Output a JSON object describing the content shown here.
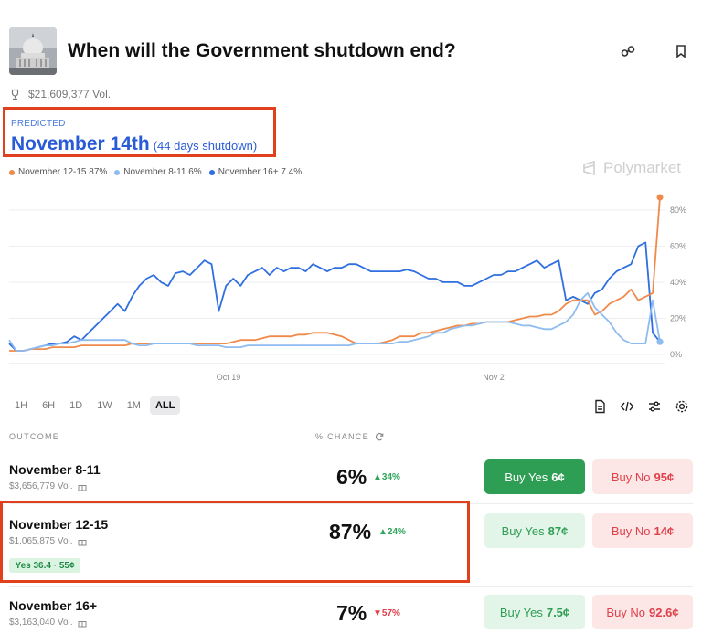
{
  "market": {
    "title": "When will the Government shutdown end?",
    "volume": "$21,609,377 Vol.",
    "predicted_label": "PREDICTED",
    "predicted_value": "November 14th",
    "predicted_note": "(44 days shutdown)",
    "watermark": "Polymarket"
  },
  "legend": [
    {
      "label": "November 12-15 87%",
      "color": "#f08a4b"
    },
    {
      "label": "November 8-11 6%",
      "color": "#8fbcf0"
    },
    {
      "label": "November 16+ 7.4%",
      "color": "#2f6fe0"
    }
  ],
  "time_ranges": [
    "1H",
    "6H",
    "1D",
    "1W",
    "1M",
    "ALL"
  ],
  "active_range": "ALL",
  "table": {
    "col_outcome": "OUTCOME",
    "col_chance": "% CHANCE"
  },
  "outcomes": [
    {
      "name": "November 8-11",
      "volume": "$3,656,779 Vol.",
      "chance": "6%",
      "delta": "34%",
      "delta_dir": "up",
      "yes_label": "Buy Yes",
      "yes_price": "6¢",
      "no_label": "Buy No",
      "no_price": "95¢"
    },
    {
      "name": "November 12-15",
      "volume": "$1,065,875 Vol.",
      "chance": "87%",
      "delta": "24%",
      "delta_dir": "up",
      "yes_label": "Buy Yes",
      "yes_price": "87¢",
      "no_label": "Buy No",
      "no_price": "14¢",
      "badge": "Yes 36.4 · 55¢"
    },
    {
      "name": "November 16+",
      "volume": "$3,163,040 Vol.",
      "chance": "7%",
      "delta": "57%",
      "delta_dir": "down",
      "yes_label": "Buy Yes",
      "yes_price": "7.5¢",
      "no_label": "Buy No",
      "no_price": "92.6¢"
    }
  ],
  "chart_data": {
    "type": "line",
    "x_tick_labels": [
      "Oct 19",
      "Nov 2"
    ],
    "y_tick_labels": [
      "80%",
      "60%",
      "40%",
      "20%",
      "0%"
    ],
    "ylim": [
      0,
      85
    ],
    "grid": true,
    "series": [
      {
        "name": "November 16+",
        "color": "#2f6fe0",
        "values": [
          6,
          2,
          2,
          3,
          4,
          5,
          6,
          6,
          7,
          10,
          8,
          12,
          16,
          20,
          24,
          28,
          24,
          32,
          38,
          42,
          44,
          40,
          38,
          45,
          46,
          44,
          48,
          52,
          50,
          24,
          38,
          42,
          38,
          44,
          46,
          48,
          44,
          48,
          46,
          48,
          48,
          46,
          50,
          48,
          46,
          48,
          48,
          50,
          50,
          48,
          46,
          46,
          46,
          46,
          46,
          47,
          46,
          44,
          42,
          42,
          40,
          40,
          40,
          38,
          38,
          40,
          42,
          44,
          44,
          46,
          46,
          48,
          50,
          52,
          48,
          50,
          52,
          30,
          32,
          30,
          28,
          34,
          36,
          42,
          46,
          48,
          50,
          60,
          62,
          12,
          7
        ]
      },
      {
        "name": "November 12-15",
        "color": "#f08a4b",
        "values": [
          2,
          2,
          2,
          3,
          3,
          3,
          4,
          4,
          4,
          4,
          5,
          5,
          5,
          5,
          5,
          5,
          5,
          6,
          6,
          6,
          6,
          6,
          6,
          6,
          6,
          6,
          6,
          6,
          6,
          6,
          6,
          7,
          8,
          8,
          8,
          9,
          10,
          10,
          10,
          10,
          11,
          11,
          12,
          12,
          12,
          11,
          10,
          8,
          6,
          6,
          6,
          6,
          7,
          8,
          10,
          10,
          10,
          12,
          12,
          13,
          14,
          15,
          16,
          16,
          17,
          17,
          18,
          18,
          18,
          18,
          19,
          20,
          21,
          21,
          22,
          22,
          24,
          28,
          30,
          30,
          30,
          22,
          24,
          28,
          30,
          32,
          36,
          30,
          32,
          34,
          87
        ]
      },
      {
        "name": "November 8-11",
        "color": "#8fbcf0",
        "values": [
          8,
          2,
          2,
          3,
          4,
          5,
          5,
          6,
          6,
          7,
          8,
          8,
          8,
          8,
          8,
          8,
          8,
          6,
          5,
          5,
          6,
          6,
          6,
          6,
          6,
          6,
          5,
          5,
          5,
          5,
          4,
          4,
          4,
          5,
          5,
          5,
          5,
          5,
          5,
          5,
          5,
          5,
          5,
          5,
          5,
          5,
          5,
          5,
          6,
          6,
          6,
          6,
          6,
          6,
          7,
          7,
          8,
          9,
          10,
          12,
          12,
          14,
          15,
          16,
          16,
          17,
          18,
          18,
          18,
          18,
          17,
          16,
          16,
          15,
          14,
          14,
          16,
          18,
          22,
          30,
          34,
          26,
          22,
          18,
          12,
          8,
          6,
          6,
          6,
          30,
          7
        ]
      }
    ]
  }
}
